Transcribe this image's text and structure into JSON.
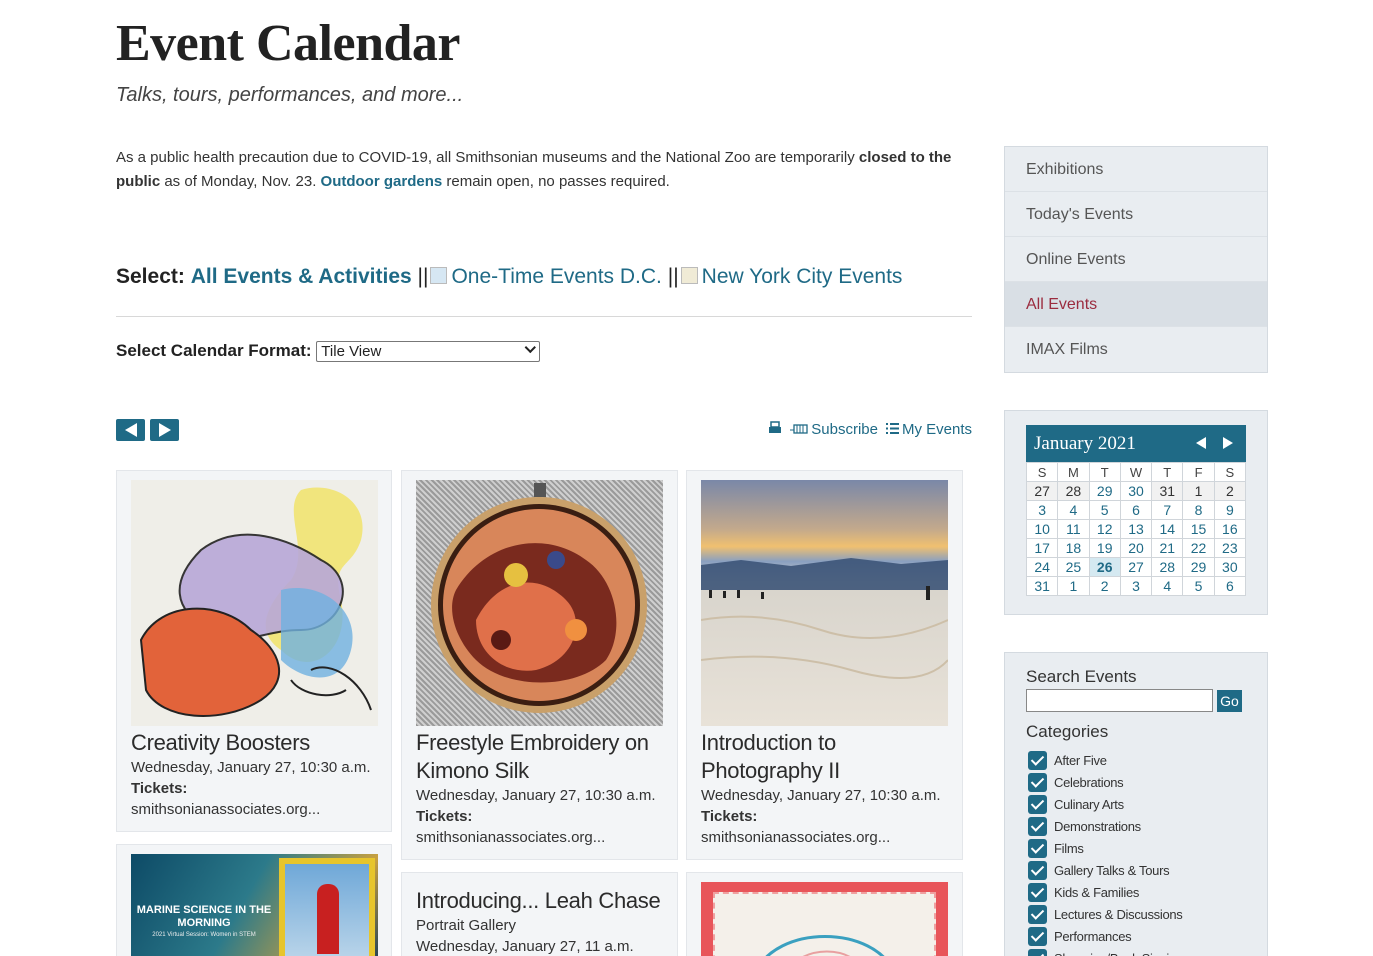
{
  "header": {
    "title": "Event Calendar",
    "subtitle": "Talks, tours, performances, and more..."
  },
  "notice": {
    "part1": "As a public health precaution due to COVID-19, all Smithsonian museums and the National Zoo are temporarily ",
    "closed": "closed to the public",
    "part2": " as of Monday, Nov. 23. ",
    "gardens_link": "Outdoor gardens",
    "part3": " remain open, no passes required."
  },
  "select": {
    "label": "Select:",
    "all_events": "All Events & Activities",
    "sep": "||",
    "one_time": "One-Time Events D.C.",
    "nyc": "New York City Events"
  },
  "format": {
    "label": "Select Calendar Format:",
    "value": "Tile View"
  },
  "tools": {
    "subscribe": "Subscribe",
    "my_events": "My Events"
  },
  "cards": [
    {
      "title": "Creativity Boosters",
      "date": "Wednesday, January 27, 10:30 a.m.",
      "tickets_label": "Tickets:",
      "tickets": "smithsonianassociates.org..."
    },
    {
      "title": "Freestyle Embroidery on Kimono Silk",
      "date": "Wednesday, January 27, 10:30 a.m.",
      "tickets_label": "Tickets:",
      "tickets": "smithsonianassociates.org..."
    },
    {
      "title": "Introduction to Photography II",
      "date": "Wednesday, January 27, 10:30 a.m.",
      "tickets_label": "Tickets:",
      "tickets": "smithsonianassociates.org..."
    },
    {
      "title": "",
      "image_text": "MARINE SCIENCE IN THE MORNING",
      "image_subtext": "2021 Virtual Session: Women in STEM"
    },
    {
      "title": "Introducing... Leah Chase",
      "location": "Portrait Gallery",
      "date": "Wednesday, January 27, 11 a.m."
    },
    {
      "title": ""
    }
  ],
  "sidebar_menu": [
    {
      "label": "Exhibitions"
    },
    {
      "label": "Today's Events"
    },
    {
      "label": "Online Events"
    },
    {
      "label": "All Events",
      "active": true
    },
    {
      "label": "IMAX Films"
    }
  ],
  "calendar": {
    "month": "January 2021",
    "weekdays": [
      "S",
      "M",
      "T",
      "W",
      "T",
      "F",
      "S"
    ],
    "weeks": [
      [
        "27",
        "28",
        "29",
        "30",
        "31",
        "1",
        "2"
      ],
      [
        "3",
        "4",
        "5",
        "6",
        "7",
        "8",
        "9"
      ],
      [
        "10",
        "11",
        "12",
        "13",
        "14",
        "15",
        "16"
      ],
      [
        "17",
        "18",
        "19",
        "20",
        "21",
        "22",
        "23"
      ],
      [
        "24",
        "25",
        "26",
        "27",
        "28",
        "29",
        "30"
      ],
      [
        "31",
        "1",
        "2",
        "3",
        "4",
        "5",
        "6"
      ]
    ],
    "today": "26"
  },
  "search": {
    "heading": "Search Events",
    "value": "",
    "go_label": "Go"
  },
  "categories": {
    "heading": "Categories",
    "items": [
      "After Five",
      "Celebrations",
      "Culinary Arts",
      "Demonstrations",
      "Films",
      "Gallery Talks & Tours",
      "Kids & Families",
      "Lectures & Discussions",
      "Performances",
      "Shopping/Book Signing"
    ]
  },
  "colors": {
    "accent": "#1f6a86",
    "active_menu": "#9b2c3f",
    "panel_bg": "#e9edf1"
  }
}
